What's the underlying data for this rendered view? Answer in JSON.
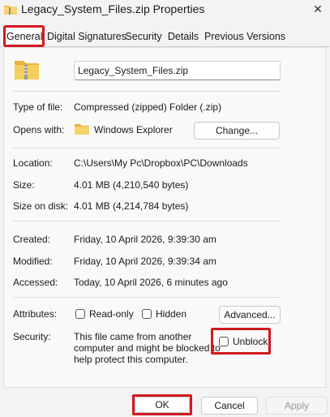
{
  "window": {
    "title": "Legacy_System_Files.zip Properties",
    "close_glyph": "✕"
  },
  "tabs": [
    {
      "label": "General",
      "active": true
    },
    {
      "label": "Digital Signatures"
    },
    {
      "label": "Security"
    },
    {
      "label": "Details"
    },
    {
      "label": "Previous Versions"
    }
  ],
  "general": {
    "file_name": "Legacy_System_Files.zip",
    "type_label": "Type of file:",
    "type_value": "Compressed (zipped) Folder (.zip)",
    "opens_label": "Opens with:",
    "opens_value": "Windows Explorer",
    "change_button": "Change...",
    "location_label": "Location:",
    "location_value": "C:\\Users\\My Pc\\Dropbox\\PC\\Downloads",
    "size_label": "Size:",
    "size_value": "4.01 MB (4,210,540 bytes)",
    "size_disk_label": "Size on disk:",
    "size_disk_value": "4.01 MB (4,214,784 bytes)",
    "created_label": "Created:",
    "created_value": "Friday, 10 April 2026, 9:39:30 am",
    "modified_label": "Modified:",
    "modified_value": "Friday, 10 April 2026, 9:39:34 am",
    "accessed_label": "Accessed:",
    "accessed_value": "Today, 10 April 2026, 6 minutes ago",
    "attributes_label": "Attributes:",
    "readonly_label": "Read-only",
    "hidden_label": "Hidden",
    "advanced_button": "Advanced...",
    "security_label": "Security:",
    "security_line1": "This file came from another",
    "security_line2": "computer and might be blocked to",
    "security_line3": "help protect this computer.",
    "unblock_label": "Unblock"
  },
  "footer": {
    "ok": "OK",
    "cancel": "Cancel",
    "apply": "Apply"
  },
  "colors": {
    "highlight": "#d11920",
    "folder": "#f0c24a"
  }
}
